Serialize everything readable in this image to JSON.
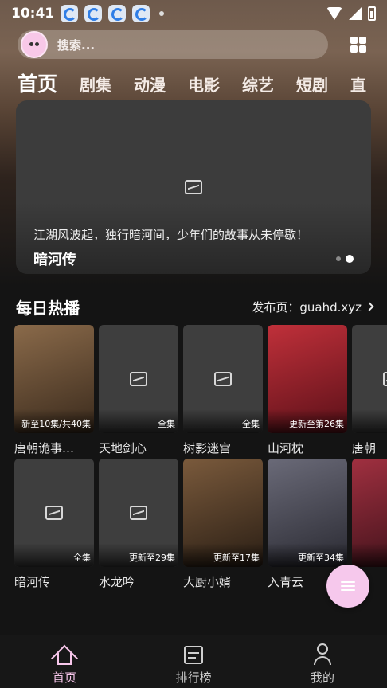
{
  "status_bar": {
    "time": "10:41"
  },
  "search": {
    "placeholder": "搜索..."
  },
  "tabs": [
    {
      "label": "首页",
      "active": true
    },
    {
      "label": "剧集"
    },
    {
      "label": "动漫"
    },
    {
      "label": "电影"
    },
    {
      "label": "综艺"
    },
    {
      "label": "短剧"
    },
    {
      "label": "直"
    }
  ],
  "banner": {
    "description": "江湖风波起，独行暗河间，少年们的故事从未停歇！",
    "title": "暗河传",
    "slide_count": 2,
    "active_slide": 2
  },
  "section": {
    "title": "每日热播",
    "link": "发布页：guahd.xyz"
  },
  "cards": [
    {
      "title": "唐朝诡事…",
      "badge": "新至10集/共40集",
      "image": true,
      "c1": "#8a6a4a",
      "c2": "#3a2a1c"
    },
    {
      "title": "天地剑心",
      "badge": "全集",
      "image": false
    },
    {
      "title": "树影迷宫",
      "badge": "全集",
      "image": false
    },
    {
      "title": "山河枕",
      "badge": "更新至第26集",
      "image": true,
      "c1": "#c0303a",
      "c2": "#5a1018"
    },
    {
      "title": "唐朝",
      "badge": "",
      "image": false
    },
    {
      "title": "暗河传",
      "badge": "全集",
      "image": false
    },
    {
      "title": "水龙吟",
      "badge": "更新至29集",
      "image": false
    },
    {
      "title": "大厨小婿",
      "badge": "更新至17集",
      "image": true,
      "c1": "#7a5a3c",
      "c2": "#2a1e14"
    },
    {
      "title": "入青云",
      "badge": "更新至34集",
      "image": true,
      "c1": "#6a6a78",
      "c2": "#2a2a32"
    },
    {
      "title": "",
      "badge": "",
      "image": true,
      "c1": "#a03040",
      "c2": "#3a1018"
    }
  ],
  "nav": [
    {
      "label": "首页",
      "icon": "home-icon",
      "active": true
    },
    {
      "label": "排行榜",
      "icon": "rank-icon"
    },
    {
      "label": "我的",
      "icon": "user-icon"
    }
  ]
}
